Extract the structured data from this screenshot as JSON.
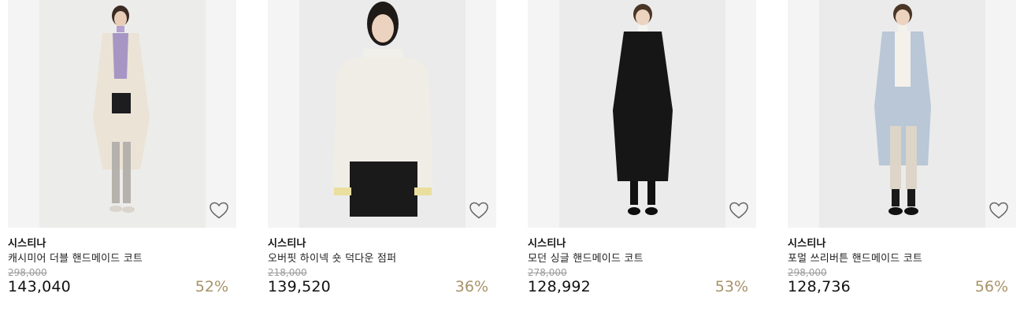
{
  "accent_color": "#a89267",
  "products": [
    {
      "brand": "시스티나",
      "name": "캐시미어 더블 핸드메이드 코트",
      "original_price": "298,000",
      "price": "143,040",
      "discount": "52%",
      "coat_color": "#ebe3d5",
      "wish_icon": "heart-outline-icon"
    },
    {
      "brand": "시스티나",
      "name": "오버핏 하이넥 숏 덕다운 점퍼",
      "original_price": "218,000",
      "price": "139,520",
      "discount": "36%",
      "coat_color": "#efede6",
      "wish_icon": "heart-outline-icon"
    },
    {
      "brand": "시스티나",
      "name": "모던 싱글 핸드메이드 코트",
      "original_price": "278,000",
      "price": "128,992",
      "discount": "53%",
      "coat_color": "#161616",
      "wish_icon": "heart-outline-icon"
    },
    {
      "brand": "시스티나",
      "name": "포멀 쓰리버튼 핸드메이드 코트",
      "original_price": "298,000",
      "price": "128,736",
      "discount": "56%",
      "coat_color": "#b9c7d7",
      "wish_icon": "heart-outline-icon"
    }
  ]
}
